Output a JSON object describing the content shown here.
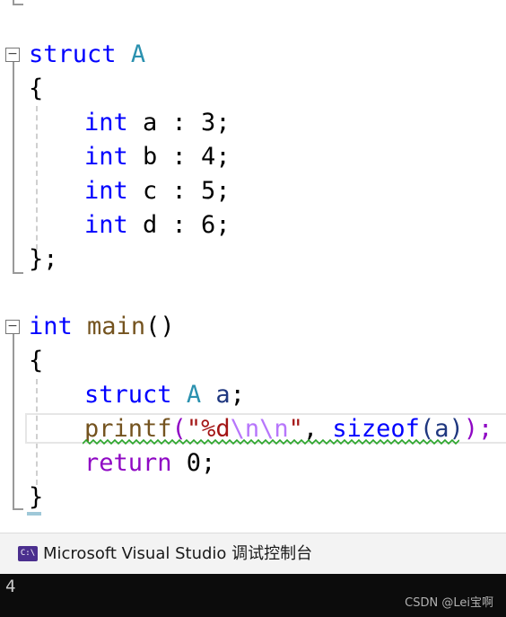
{
  "editor": {
    "lines": {
      "struct_header": {
        "kw": "struct",
        "name": "A"
      },
      "open_brace_1": "{",
      "field_a": {
        "type": "int",
        "rest": " a : 3;"
      },
      "field_b": {
        "type": "int",
        "rest": " b : 4;"
      },
      "field_c": {
        "type": "int",
        "rest": " c : 5;"
      },
      "field_d": {
        "type": "int",
        "rest": " d : 6;"
      },
      "close_brace_1": "};",
      "main_header": {
        "type": "int",
        "fn": "main",
        "parens": "()"
      },
      "open_brace_2": "{",
      "decl": {
        "kw": "struct",
        "type": "A",
        "var": "a",
        "end": ";"
      },
      "printf": {
        "fn": "printf",
        "open": "(",
        "q1": "\"",
        "fmt": "%d",
        "esc1": "\\n",
        "esc2": "\\n",
        "q2": "\"",
        "comma": ", ",
        "sizeof": "sizeof",
        "arg_open": "(",
        "arg": "a",
        "arg_close": ")",
        "close": ");"
      },
      "return": {
        "kw": "return",
        "rest": " 0;"
      },
      "close_brace_2": "}"
    },
    "fold_minus": "−"
  },
  "console": {
    "icon_text": "C:\\",
    "title": "Microsoft Visual Studio 调试控制台",
    "output": "4"
  },
  "watermark": "CSDN @Lei宝啊",
  "colors": {
    "keyword": "#0000ff",
    "type": "#2b91af",
    "function": "#74531f",
    "control": "#8f08c4",
    "string": "#a31515",
    "escape": "#b776fb",
    "console_bg": "#0c0c0c"
  }
}
